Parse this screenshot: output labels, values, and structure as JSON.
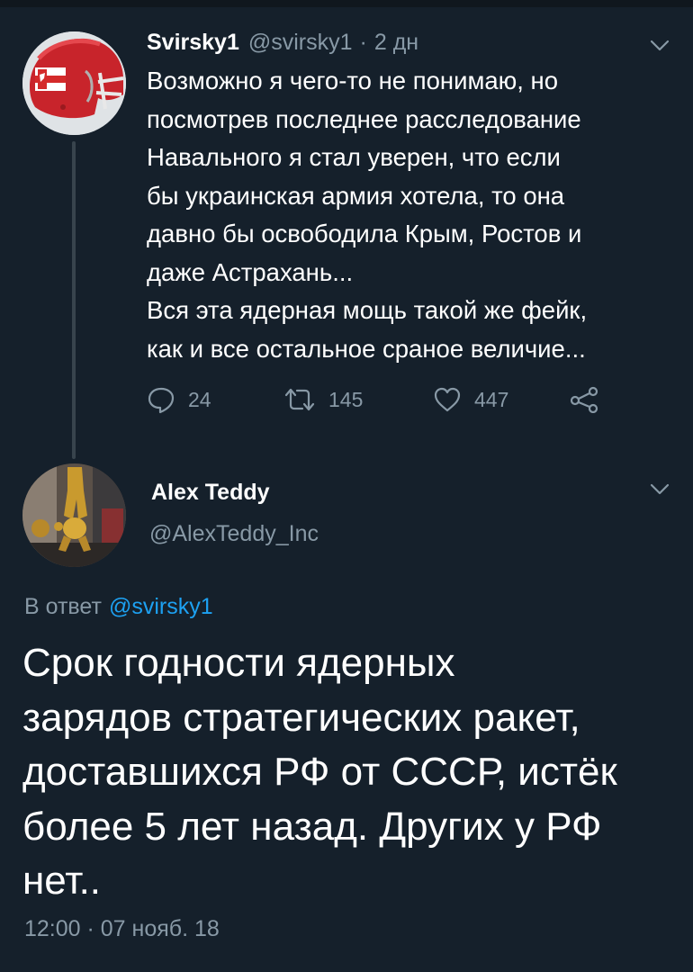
{
  "colors": {
    "background": "#15202b",
    "text_primary": "#ffffff",
    "text_secondary": "#8899a6",
    "accent": "#1da1f2",
    "thread_line": "#38444d"
  },
  "tweet1": {
    "display_name": "Svirsky1",
    "handle": "@svirsky1",
    "separator": "·",
    "time_ago": "2 дн",
    "text_lines": [
      "Возможно я чего-то не понимаю, но",
      "посмотрев последнее расследование",
      "Навального я стал уверен, что если",
      "бы украинская армия хотела, то она",
      "давно бы освободила Крым, Ростов и",
      "даже Астрахань...",
      "Вся эта ядерная мощь такой же фейк,",
      "как и все остальное сраное величие..."
    ],
    "actions": {
      "reply_count": "24",
      "retweet_count": "145",
      "like_count": "447"
    },
    "icons": [
      "avatar-flag-helmet",
      "chevron-down-icon",
      "reply-icon",
      "retweet-icon",
      "like-icon",
      "share-icon"
    ]
  },
  "tweet2": {
    "display_name": "Alex Teddy",
    "handle": "@AlexTeddy_Inc",
    "reply_prefix": "В ответ",
    "reply_mention": "@svirsky1",
    "text_lines": [
      "Срок годности ядерных",
      "зарядов стратегических ракет,",
      "доставшихся РФ от СССР, истёк",
      "более 5 лет назад. Других у РФ",
      "нет.."
    ],
    "timestamp": "12:00 · 07 нояб. 18",
    "icons": [
      "avatar-golden-statue",
      "chevron-down-icon"
    ]
  }
}
